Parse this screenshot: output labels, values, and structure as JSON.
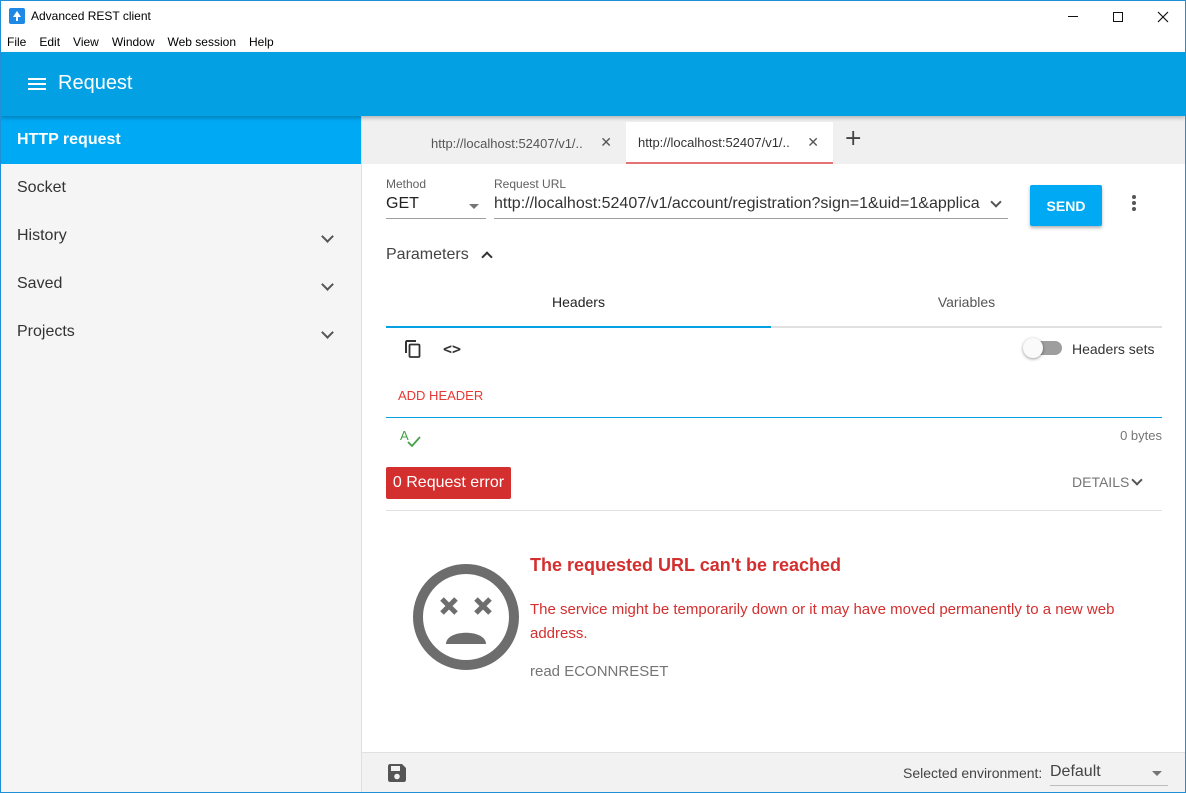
{
  "window": {
    "title": "Advanced REST client"
  },
  "menubar": {
    "items": [
      "File",
      "Edit",
      "View",
      "Window",
      "Web session",
      "Help"
    ]
  },
  "appbar": {
    "title": "Request"
  },
  "sidebar": {
    "items": [
      {
        "label": "HTTP request",
        "active": true,
        "expandable": false
      },
      {
        "label": "Socket",
        "active": false,
        "expandable": false
      },
      {
        "label": "History",
        "active": false,
        "expandable": true
      },
      {
        "label": "Saved",
        "active": false,
        "expandable": true
      },
      {
        "label": "Projects",
        "active": false,
        "expandable": true
      }
    ]
  },
  "tabs": {
    "items": [
      {
        "label": "http://localhost:52407/v1/..",
        "active": false
      },
      {
        "label": "http://localhost:52407/v1/..",
        "active": true
      }
    ],
    "add_label": "+"
  },
  "request": {
    "method_label": "Method",
    "method_value": "GET",
    "url_label": "Request URL",
    "url_value": "http://localhost:52407/v1/account/registration?sign=1&uid=1&applica",
    "send_label": "SEND",
    "parameters_label": "Parameters"
  },
  "editor": {
    "tabs": [
      "Headers",
      "Variables"
    ],
    "active_tab": "Headers",
    "headers_sets_label": "Headers sets",
    "headers_sets_enabled": false,
    "add_header_label": "ADD HEADER",
    "size_label": "0 bytes"
  },
  "response": {
    "status_badge": "0 Request error",
    "details_label": "DETAILS",
    "error_title": "The requested URL can't be reached",
    "error_message": "The service might be temporarily down or it may have moved permanently to a new web address.",
    "error_code": "read ECONNRESET"
  },
  "footer": {
    "env_label": "Selected environment:",
    "env_value": "Default"
  },
  "colors": {
    "accent": "#03a0e3",
    "active_nav": "#00a9f4",
    "error": "#d32f2f",
    "add_header": "#e53935"
  }
}
